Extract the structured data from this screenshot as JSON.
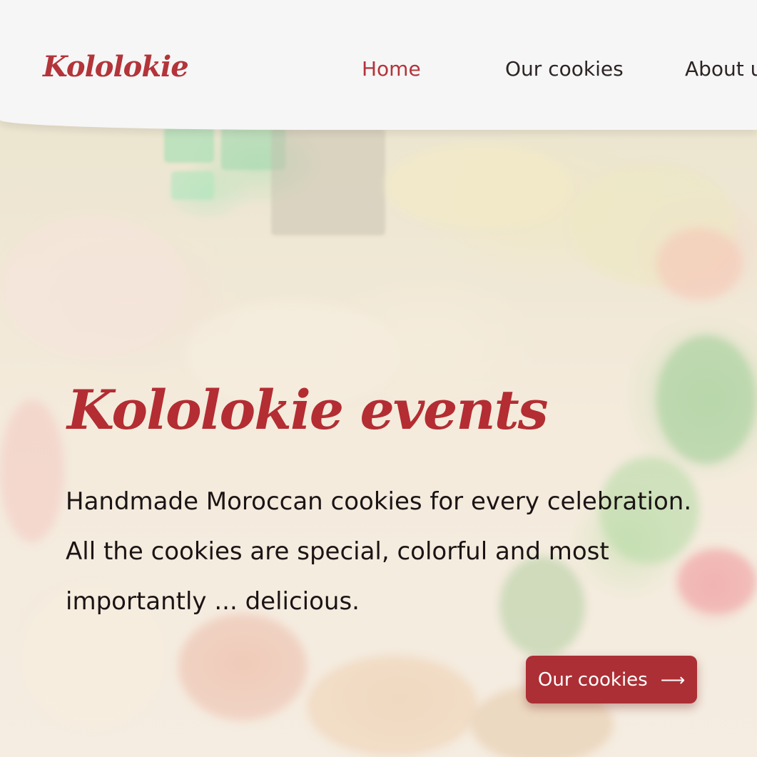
{
  "brand": {
    "logo_text": "Kololokie",
    "accent_color": "#b3343a"
  },
  "nav": {
    "items": [
      {
        "label": "Home",
        "active": true
      },
      {
        "label": "Our cookies",
        "active": false
      },
      {
        "label": "About u",
        "active": false
      }
    ]
  },
  "hero": {
    "title": "Kololokie events",
    "description": "Handmade Moroccan cookies for every celebration. All the cookies are special, colorful and most importantly ... delicious.",
    "background_image": "moroccan-cookies-photo",
    "cta": {
      "label": "Our cookies",
      "icon": "arrow-right-icon"
    }
  }
}
